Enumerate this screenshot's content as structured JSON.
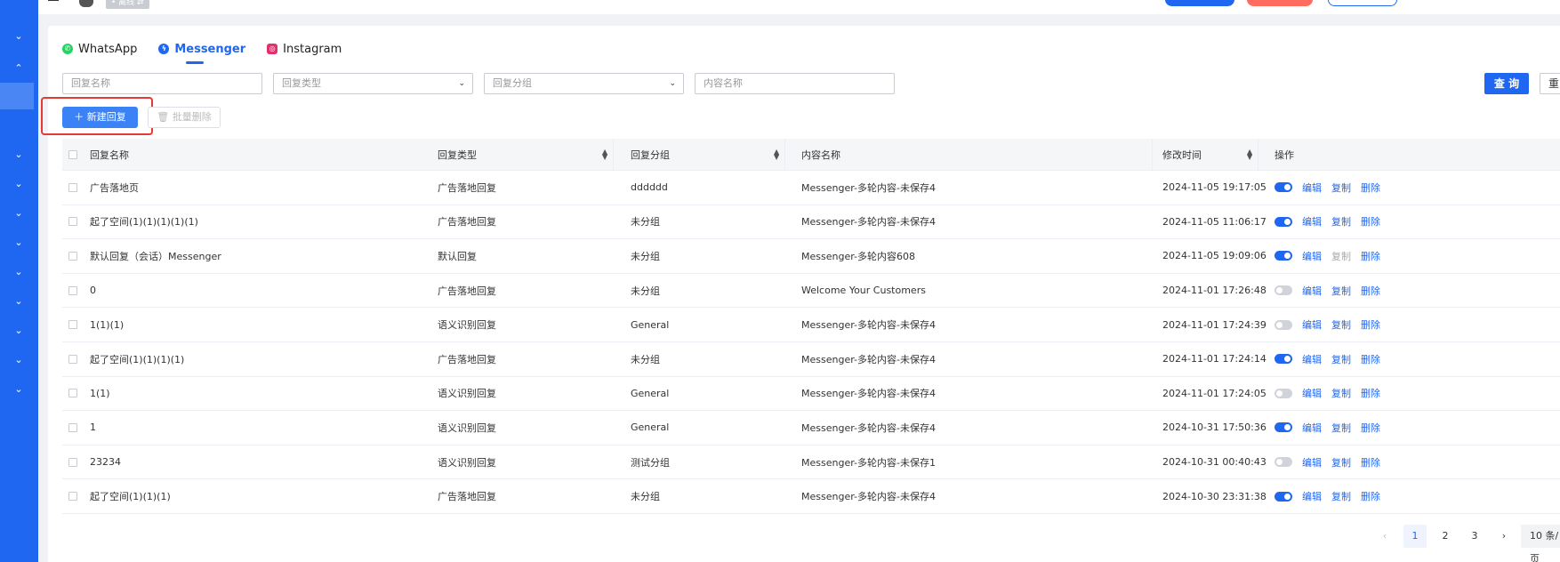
{
  "sidebar": {
    "logo": "..."
  },
  "topbar": {
    "status": "• 离线 ⇄"
  },
  "tabs": [
    {
      "label": "WhatsApp",
      "icon": "whatsapp-icon",
      "color": "#25d366"
    },
    {
      "label": "Messenger",
      "icon": "messenger-icon",
      "color": "#1f67f1"
    },
    {
      "label": "Instagram",
      "icon": "instagram-icon",
      "color": "#e1306c"
    }
  ],
  "filters": {
    "reply_name_placeholder": "回复名称",
    "reply_type_placeholder": "回复类型",
    "reply_group_placeholder": "回复分组",
    "content_name_placeholder": "内容名称"
  },
  "buttons": {
    "query": "查 询",
    "reset": "重",
    "new_reply": "新建回复",
    "batch_delete": "批量删除"
  },
  "table": {
    "headers": [
      "回复名称",
      "回复类型",
      "回复分组",
      "内容名称",
      "修改时间",
      "操作"
    ],
    "actions": {
      "edit": "编辑",
      "copy": "复制",
      "delete": "删除"
    },
    "rows": [
      {
        "name": "广告落地页",
        "type": "广告落地回复",
        "group": "dddddd",
        "content": "Messenger-多轮内容-未保存4",
        "time": "2024-11-05 19:17:05",
        "enabled": true,
        "copy_enabled": true
      },
      {
        "name": "起了空间(1)(1)(1)(1)(1)",
        "type": "广告落地回复",
        "group": "未分组",
        "content": "Messenger-多轮内容-未保存4",
        "time": "2024-11-05 11:06:17",
        "enabled": true,
        "copy_enabled": true
      },
      {
        "name": "默认回复（会话）Messenger",
        "type": "默认回复",
        "group": "未分组",
        "content": "Messenger-多轮内容608",
        "time": "2024-11-05 19:09:06",
        "enabled": true,
        "copy_enabled": false
      },
      {
        "name": "0",
        "type": "广告落地回复",
        "group": "未分组",
        "content": "Welcome Your Customers",
        "time": "2024-11-01 17:26:48",
        "enabled": false,
        "copy_enabled": true
      },
      {
        "name": "1(1)(1)",
        "type": "语义识别回复",
        "group": "General",
        "content": "Messenger-多轮内容-未保存4",
        "time": "2024-11-01 17:24:39",
        "enabled": false,
        "copy_enabled": true
      },
      {
        "name": "起了空间(1)(1)(1)(1)",
        "type": "广告落地回复",
        "group": "未分组",
        "content": "Messenger-多轮内容-未保存4",
        "time": "2024-11-01 17:24:14",
        "enabled": true,
        "copy_enabled": true
      },
      {
        "name": "1(1)",
        "type": "语义识别回复",
        "group": "General",
        "content": "Messenger-多轮内容-未保存4",
        "time": "2024-11-01 17:24:05",
        "enabled": false,
        "copy_enabled": true
      },
      {
        "name": "1",
        "type": "语义识别回复",
        "group": "General",
        "content": "Messenger-多轮内容-未保存4",
        "time": "2024-10-31 17:50:36",
        "enabled": true,
        "copy_enabled": true
      },
      {
        "name": "23234",
        "type": "语义识别回复",
        "group": "测试分组",
        "content": "Messenger-多轮内容-未保存1",
        "time": "2024-10-31 00:40:43",
        "enabled": false,
        "copy_enabled": true
      },
      {
        "name": "起了空间(1)(1)(1)",
        "type": "广告落地回复",
        "group": "未分组",
        "content": "Messenger-多轮内容-未保存4",
        "time": "2024-10-30 23:31:38",
        "enabled": true,
        "copy_enabled": true
      }
    ]
  },
  "pagination": {
    "prev": "‹",
    "pages": [
      "1",
      "2",
      "3"
    ],
    "current": "1",
    "next": "›",
    "page_size": "10 条/页"
  },
  "colors": {
    "primary": "#1f67f1",
    "highlight": "#e53935"
  }
}
